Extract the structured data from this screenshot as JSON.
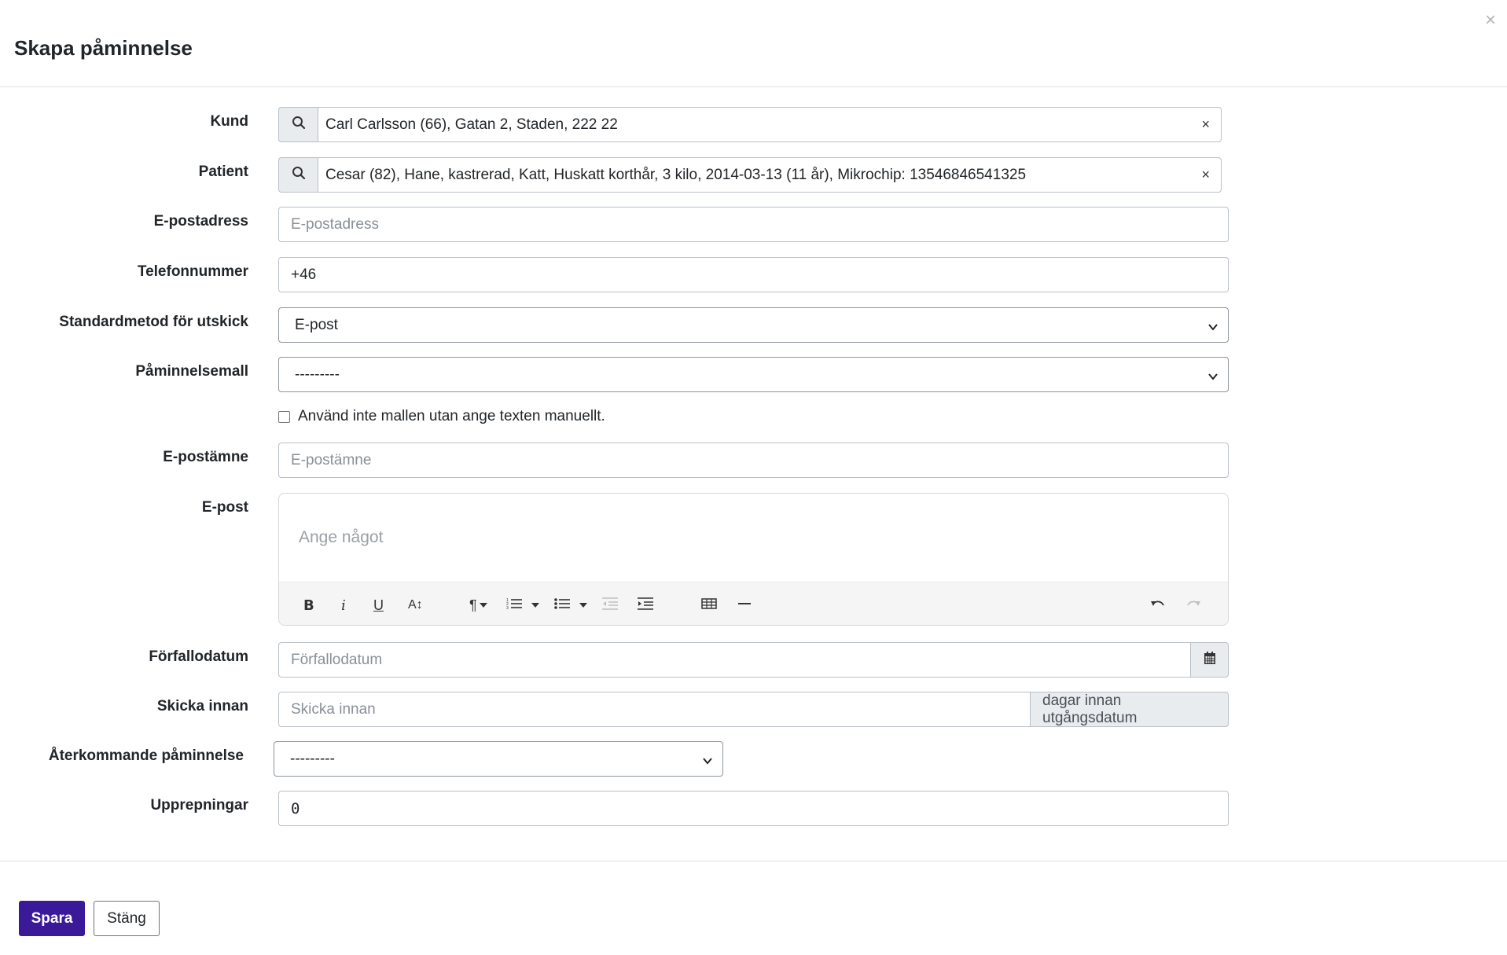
{
  "modal": {
    "title": "Skapa påminnelse",
    "close_symbol": "×"
  },
  "form": {
    "kund": {
      "label": "Kund",
      "value": "Carl Carlsson (66), Gatan 2, Staden, 222 22",
      "clear_symbol": "×"
    },
    "patient": {
      "label": "Patient",
      "value": "Cesar (82), Hane, kastrerad, Katt, Huskatt korthår, 3 kilo, 2014-03-13 (11 år), Mikrochip: 13546846541325",
      "clear_symbol": "×"
    },
    "email": {
      "label": "E-postadress",
      "placeholder": "E-postadress"
    },
    "phone": {
      "label": "Telefonnummer",
      "value": "+46"
    },
    "default_method": {
      "label": "Standardmetod för utskick",
      "selected": "E-post"
    },
    "template": {
      "label": "Påminnelsemall",
      "selected": "---------"
    },
    "manual_checkbox": {
      "label": "Använd inte mallen utan ange texten manuellt.",
      "checked": false
    },
    "subject": {
      "label": "E-postämne",
      "placeholder": "E-postämne"
    },
    "body": {
      "label": "E-post",
      "placeholder": "Ange något",
      "toolbar": {
        "bold": "B",
        "italic": "i",
        "underline": "U",
        "font_size": "A↕",
        "paragraph": "¶",
        "ordered_list": "ordered-list-icon",
        "unordered_list": "unordered-list-icon",
        "outdent": "outdent-icon",
        "indent": "indent-icon",
        "table": "table-icon",
        "hr": "horizontal-rule-icon",
        "undo": "undo-icon",
        "redo": "redo-icon"
      }
    },
    "due_date": {
      "label": "Förfallodatum",
      "placeholder": "Förfallodatum"
    },
    "send_before": {
      "label": "Skicka innan",
      "placeholder": "Skicka innan",
      "suffix": "dagar innan utgångsdatum"
    },
    "recurring": {
      "label": "Återkommande påminnelse",
      "selected": "---------"
    },
    "repetitions": {
      "label": "Upprepningar",
      "value": "0"
    }
  },
  "footer": {
    "save_label": "Spara",
    "close_label": "Stäng"
  },
  "colors": {
    "primary": "#3b1a9a",
    "border": "#b9c0c7",
    "addon_bg": "#e9ecef"
  }
}
